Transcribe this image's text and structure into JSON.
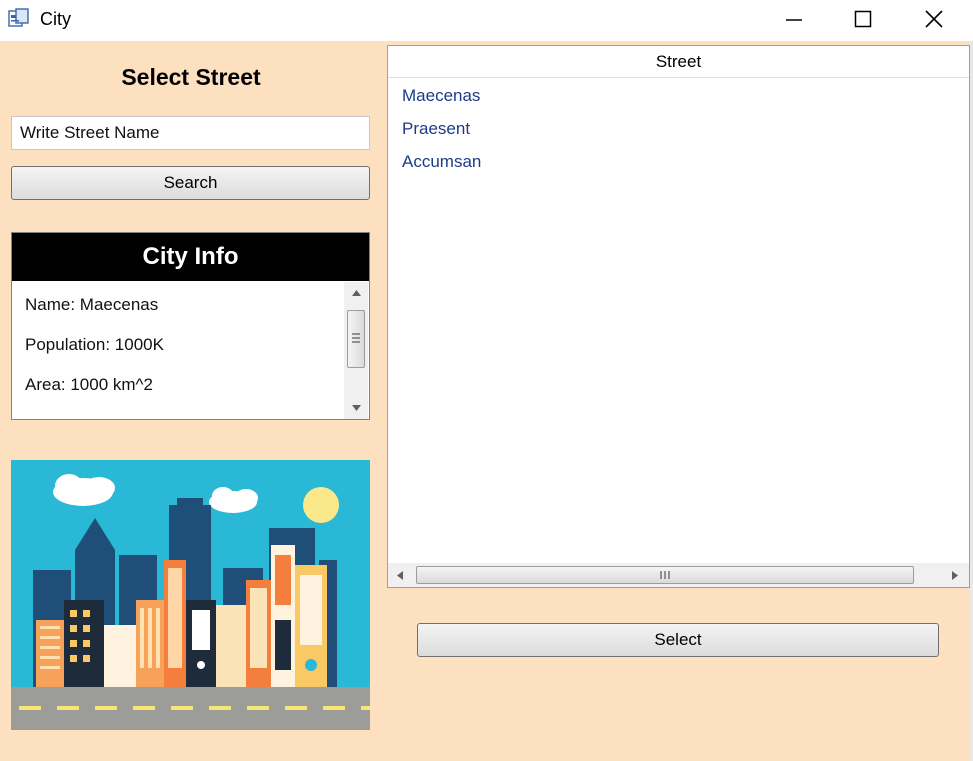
{
  "window": {
    "title": "City",
    "controls": {
      "minimize": "minimize-icon",
      "maximize": "maximize-icon",
      "close": "close-icon"
    }
  },
  "left_panel": {
    "heading": "Select Street",
    "search_input": {
      "value": "Write Street Name",
      "placeholder": ""
    },
    "search_button": "Search",
    "city_info": {
      "header": "City Info",
      "rows": [
        "Name: Maecenas",
        "Population: 1000K",
        "Area: 1000 km^2"
      ]
    },
    "image": "city-skyline-illustration"
  },
  "right_panel": {
    "grid": {
      "column_header": "Street",
      "rows": [
        "Maecenas",
        "Praesent",
        "Accumsan"
      ]
    },
    "select_button": "Select"
  },
  "colors": {
    "background": "#fce0c0",
    "info_header": "#000000",
    "row_text": "#1f3a87",
    "sky": "#29b8d6"
  }
}
